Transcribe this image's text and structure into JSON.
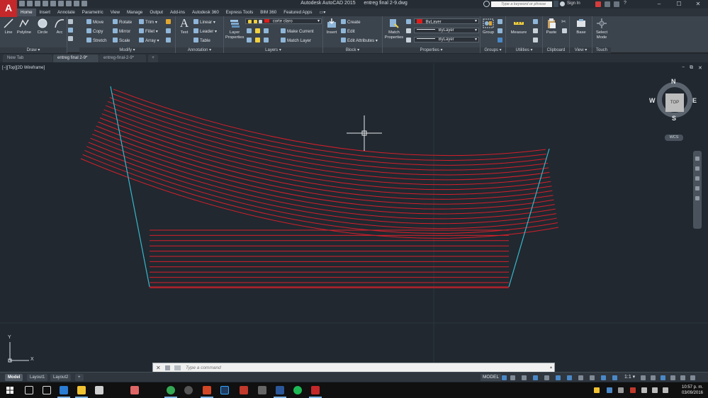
{
  "app": {
    "title": "Autodesk AutoCAD 2015",
    "file_title": "entreg final 2-9.dwg",
    "logo_letter": "A",
    "search_placeholder": "Type a keyword or phrase",
    "sign_in": "Sign In",
    "window_controls": [
      "–",
      "☐",
      "✕"
    ]
  },
  "ribbon_tabs": [
    "Home",
    "Insert",
    "Annotate",
    "Parametric",
    "View",
    "Manage",
    "Output",
    "Add-ins",
    "Autodesk 360",
    "Express Tools",
    "BIM 360",
    "Featured Apps"
  ],
  "ribbon": {
    "draw": {
      "label": "Draw ▾",
      "buttons": [
        "Line",
        "Polyline",
        "Circle",
        "Arc"
      ]
    },
    "modify": {
      "label": "Modify ▾",
      "rows": [
        [
          "Move",
          "Rotate",
          "Trim ▾"
        ],
        [
          "Copy",
          "Mirror",
          "Fillet ▾"
        ],
        [
          "Stretch",
          "Scale",
          "Array ▾"
        ]
      ]
    },
    "annotation": {
      "label": "Annotation ▾",
      "text": "Text",
      "items": [
        "Linear ▾",
        "Leader ▾",
        "Table"
      ]
    },
    "layers": {
      "label": "Layers ▾",
      "layer_properties": [
        "Layer",
        "Properties"
      ],
      "current_layer": "corte claro",
      "layer_color": "#e11b1b",
      "make_current": "Make Current",
      "match_layer": "Match Layer"
    },
    "block": {
      "label": "Block ▾",
      "insert": "Insert",
      "items": [
        "Create",
        "Edit",
        "Edit Attributes ▾"
      ]
    },
    "properties": {
      "label": "Properties ▾",
      "match": [
        "Match",
        "Properties"
      ],
      "color": "ByLayer",
      "color_swatch": "#e11b1b",
      "linetype": "ByLayer",
      "lineweight": "ByLayer"
    },
    "groups": {
      "label": "Groups ▾",
      "group": "Group"
    },
    "utilities": {
      "label": "Utilities ▾",
      "measure": "Measure"
    },
    "clipboard": {
      "label": "Clipboard",
      "paste": "Paste"
    },
    "view": {
      "label": "View ▾",
      "base": "Base"
    },
    "touch": {
      "label": "Touch",
      "select_mode": [
        "Select",
        "Mode"
      ]
    }
  },
  "file_tabs": [
    "New Tab",
    "entreg final 2-9*",
    "entreg-final-2-9*",
    "+"
  ],
  "viewport": {
    "label": "[−][Top][2D Wireframe]",
    "controls": [
      "−",
      "⧉",
      "✕"
    ],
    "viewcube": {
      "face": "TOP",
      "north": "N",
      "south": "S",
      "east": "E",
      "west": "W",
      "wcs": "WCS"
    },
    "ucs": {
      "x": "X",
      "y": "Y"
    },
    "colors": {
      "background": "#212830",
      "curves": "#d61f2a",
      "sides": "#38b7c9",
      "grid": "#2b333c"
    }
  },
  "command_line": {
    "placeholder": "Type a command",
    "close": "✕",
    "recent": "▸▾",
    "scroll": "▴"
  },
  "layout_tabs": [
    "Model",
    "Layout1",
    "Layout2",
    "+"
  ],
  "status": {
    "model": "MODEL",
    "scale": "1:1 ▾"
  },
  "taskbar": {
    "apps": [
      "task-view",
      "edge",
      "file-explorer",
      "store",
      "paint",
      "chrome",
      "media",
      "powerpoint",
      "photoshop",
      "sketchup",
      "visio",
      "word",
      "spotify",
      "autocad"
    ],
    "time": "10:57 p. m.",
    "date": "03/09/2016"
  }
}
